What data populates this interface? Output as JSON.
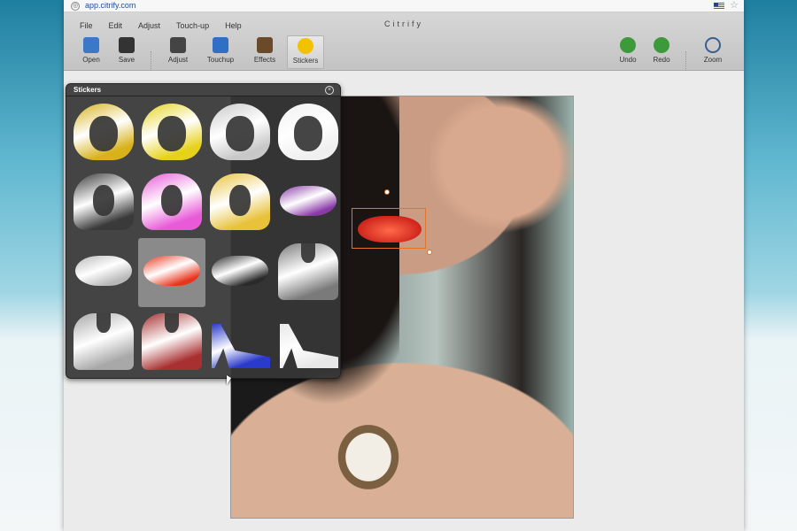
{
  "browser": {
    "url": "app.citrify.com"
  },
  "app": {
    "title": "Citrify"
  },
  "menu": [
    "File",
    "Edit",
    "Adjust",
    "Touch-up",
    "Help"
  ],
  "toolbar": {
    "open": "Open",
    "save": "Save",
    "adjust": "Adjust",
    "touchup": "Touchup",
    "effects": "Effects",
    "stickers": "Stickers",
    "undo": "Undo",
    "redo": "Redo",
    "zoom": "Zoom"
  },
  "stickers_panel": {
    "title": "Stickers",
    "close": "×"
  },
  "colors": {
    "open_icon": "#3a78c8",
    "save_icon": "#333333",
    "adjust_icon": "#444444",
    "touchup_icon": "#2f6fc4",
    "effects_icon": "#6b4a2a",
    "stickers_icon": "#f2c200",
    "undo_icon": "#3d9a3a",
    "redo_icon": "#3d9a3a",
    "zoom_icon": "#3a5f8f",
    "selection": "#e0752a"
  },
  "stickers": [
    {
      "name": "gold-short-wig-icon",
      "kind": "wig",
      "color": "#d8b21a"
    },
    {
      "name": "yellow-short-wig-icon",
      "kind": "wig",
      "color": "#e6d21c"
    },
    {
      "name": "silver-short-wig-icon",
      "kind": "wig",
      "color": "#c8c8c8"
    },
    {
      "name": "white-short-wig-icon",
      "kind": "wig",
      "color": "#f0f0f0"
    },
    {
      "name": "black-long-wig-icon",
      "kind": "longwig",
      "color": "#3a3a3a"
    },
    {
      "name": "pink-long-wig-icon",
      "kind": "longwig",
      "color": "#e85ad8"
    },
    {
      "name": "blonde-long-wig-icon",
      "kind": "longwig",
      "color": "#e8c23a"
    },
    {
      "name": "purple-lips-icon",
      "kind": "lipshape",
      "color": "#8a3aa8"
    },
    {
      "name": "silver-lips-icon",
      "kind": "lipshape",
      "color": "#b8b8b8"
    },
    {
      "name": "red-lips-icon",
      "kind": "lipshape",
      "color": "#e8351c"
    },
    {
      "name": "black-lips-icon",
      "kind": "lipshape",
      "color": "#2a2a2a"
    },
    {
      "name": "gray-beard-icon",
      "kind": "beard",
      "color": "#7a7a7a"
    },
    {
      "name": "silver-beard-icon",
      "kind": "beard",
      "color": "#a8a8a8"
    },
    {
      "name": "red-beard-icon",
      "kind": "beard",
      "color": "#a83030"
    },
    {
      "name": "blue-heel-shoe-icon",
      "kind": "shoe",
      "color": "#2a3acb"
    },
    {
      "name": "white-heel-shoe-icon",
      "kind": "shoe",
      "color": "#e8e8e8"
    }
  ],
  "selected_sticker": 9
}
